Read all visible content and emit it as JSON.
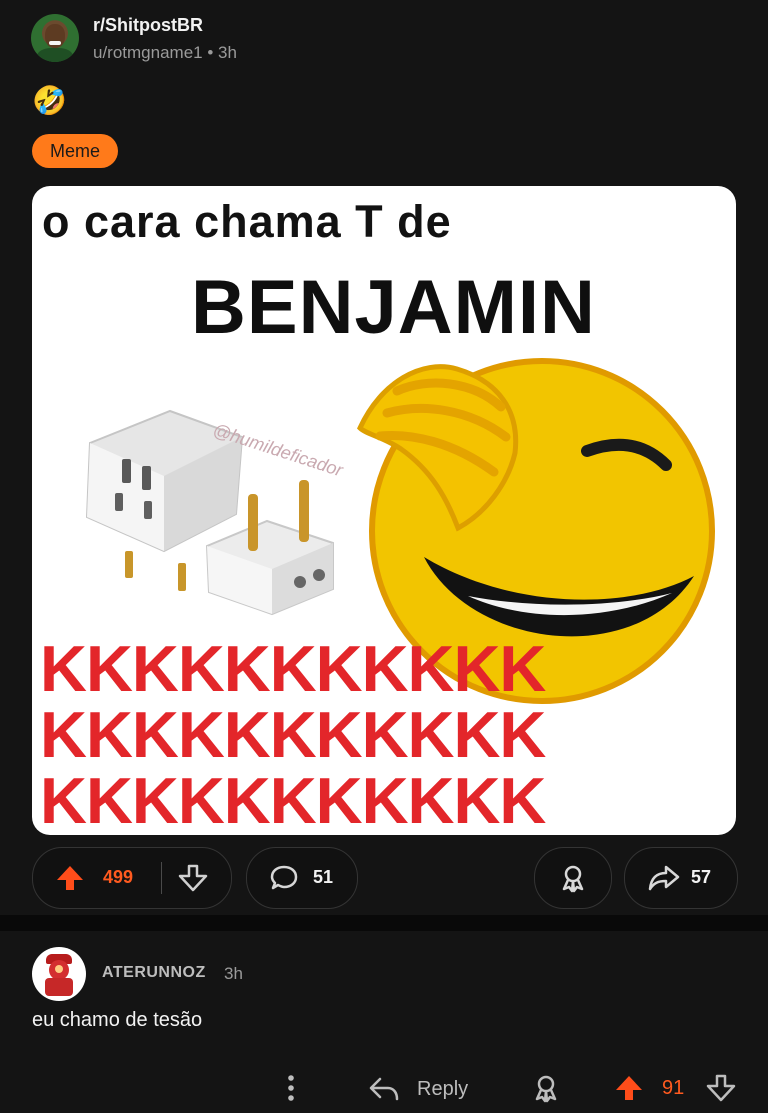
{
  "post": {
    "subreddit": "r/ShitpostBR",
    "author_line": "u/rotmgname1 • 3h",
    "emoji": "🤣",
    "flair": "Meme",
    "meme": {
      "line1": "o cara chama T de",
      "line2": "BENJAMIN",
      "k_rows": [
        "KKKKKKKKKKK",
        "KKKKKKKKKKK",
        "KKKKKKKKKKK"
      ],
      "watermark": "@humildeficador"
    },
    "actions": {
      "upvotes": "499",
      "comments": "51",
      "shares": "57"
    }
  },
  "comment": {
    "username": "ATERUNNOZ",
    "time": "3h",
    "text": "eu chamo de tesão",
    "reply_label": "Reply",
    "score": "91"
  },
  "colors": {
    "background": "#141414",
    "accent": "#ff5a1f",
    "flair": "#ff7a1a",
    "meme_red": "#e3262a"
  },
  "icons": [
    "upvote-icon",
    "downvote-icon",
    "comment-bubble-icon",
    "award-icon",
    "share-icon",
    "more-options-icon",
    "reply-icon"
  ]
}
